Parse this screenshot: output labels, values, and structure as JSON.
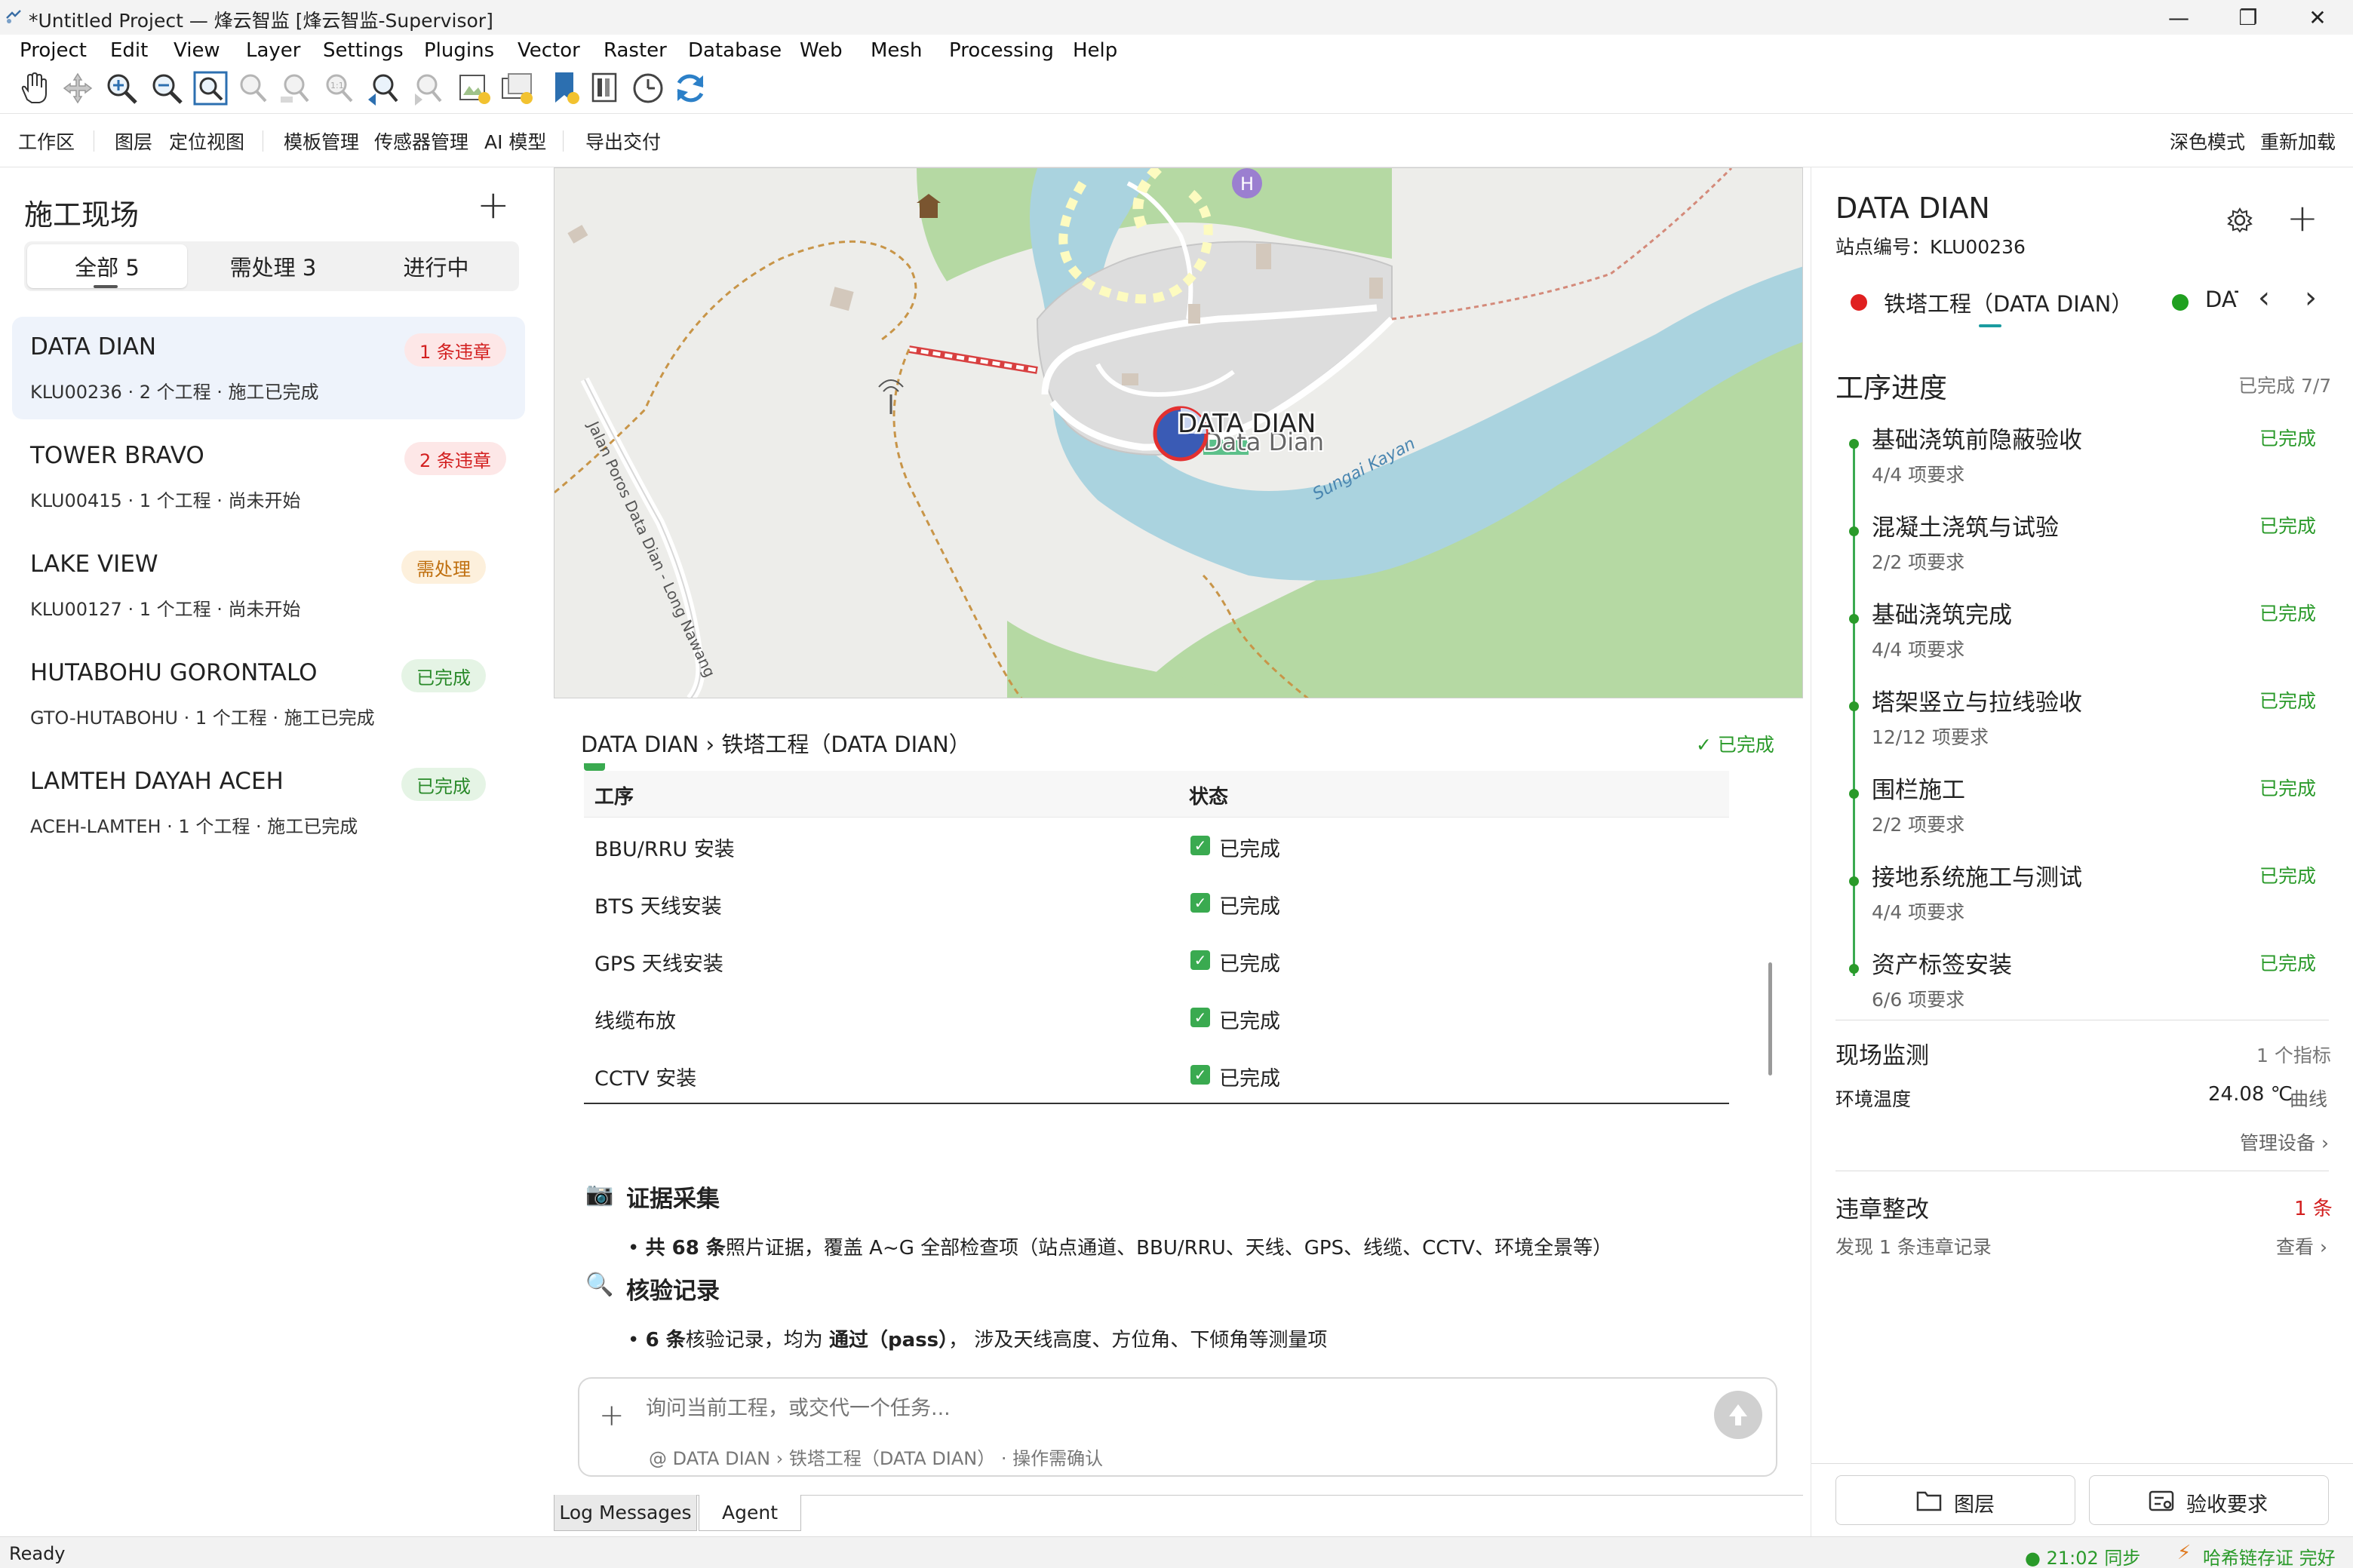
{
  "window": {
    "title": "*Untitled Project — 烽云智监 [烽云智监-Supervisor]",
    "minimize": "—",
    "maximize": "❐",
    "close": "✕"
  },
  "menubar": [
    "Project",
    "Edit",
    "View",
    "Layer",
    "Settings",
    "Plugins",
    "Vector",
    "Raster",
    "Database",
    "Web",
    "Mesh",
    "Processing",
    "Help"
  ],
  "toolbar_icons": [
    "pan-icon",
    "pan-to-selection-icon",
    "zoom-in-icon",
    "zoom-out-icon",
    "zoom-full-icon",
    "zoom-to-selection-icon",
    "zoom-to-layer-icon",
    "zoom-native-icon",
    "zoom-last-icon",
    "zoom-next-icon",
    "new-bookmark-icon",
    "show-bookmarks-icon",
    "spatial-bookmark-icon",
    "temporal-controller-icon",
    "refresh-icon"
  ],
  "navbar": {
    "left": [
      "工作区",
      "图层",
      "定位视图",
      "模板管理",
      "传感器管理",
      "AI 模型",
      "导出交付"
    ],
    "right": [
      "深色模式",
      "重新加载"
    ]
  },
  "sites_panel": {
    "title": "施工现场",
    "add": "+",
    "tabs": [
      {
        "label": "全部 5",
        "active": true
      },
      {
        "label": "需处理 3",
        "active": false
      },
      {
        "label": "进行中",
        "active": false
      }
    ],
    "sites": [
      {
        "name": "DATA DIAN",
        "sub": "KLU00236 · 2 个工程 · 施工已完成",
        "badge": "1 条违章",
        "badge_kind": "red",
        "selected": true
      },
      {
        "name": "TOWER BRAVO",
        "sub": "KLU00415 · 1 个工程 · 尚未开始",
        "badge": "2 条违章",
        "badge_kind": "red",
        "selected": false
      },
      {
        "name": "LAKE VIEW",
        "sub": "KLU00127 · 1 个工程 · 尚未开始",
        "badge": "需处理",
        "badge_kind": "orange",
        "selected": false
      },
      {
        "name": "HUTABOHU GORONTALO",
        "sub": "GTO-HUTABOHU · 1 个工程 · 施工已完成",
        "badge": "已完成",
        "badge_kind": "green",
        "selected": false
      },
      {
        "name": "LAMTEH DAYAH ACEH",
        "sub": "ACEH-LAMTEH · 1 个工程 · 施工已完成",
        "badge": "已完成",
        "badge_kind": "green",
        "selected": false
      }
    ]
  },
  "map": {
    "marker_label": "DATA DIAN",
    "town_label": "Data Dian",
    "river_label": "Sungai Kayan",
    "road_label": "Jalan Poros Data Dian - Long Nawang",
    "hospital_label": "H"
  },
  "detail": {
    "breadcrumb": "DATA DIAN › 铁塔工程（DATA DIAN）",
    "status": "✓ 已完成",
    "table_headers": [
      "工序",
      "状态"
    ],
    "table_rows": [
      {
        "name": "BBU/RRU 安装",
        "status": "已完成"
      },
      {
        "name": "BTS 天线安装",
        "status": "已完成"
      },
      {
        "name": "GPS 天线安装",
        "status": "已完成"
      },
      {
        "name": "线缆布放",
        "status": "已完成"
      },
      {
        "name": "CCTV 安装",
        "status": "已完成"
      }
    ],
    "evidence_title": "证据采集",
    "evidence_bullet_pre": "共 68 条",
    "evidence_bullet_post": "照片证据，覆盖 A~G 全部检查项（站点通道、BBU/RRU、天线、GPS、线缆、CCTV、环境全景等）",
    "inspection_title": "核验记录",
    "inspection_bullet_pre": "6 条",
    "inspection_bullet_mid": "核验记录，均为 ",
    "inspection_bullet_bold": "通过（pass）",
    "inspection_bullet_post": "， 涉及天线高度、方位角、下倾角等测量项"
  },
  "chat": {
    "placeholder": "询问当前工程，或交代一个任务...",
    "context": "@ DATA DIAN › 铁塔工程（DATA DIAN） · 操作需确认",
    "add": "+"
  },
  "bottom_tabs": [
    {
      "label": "Log Messages",
      "active": true
    },
    {
      "label": "Agent",
      "active": false
    }
  ],
  "right_panel": {
    "site_title": "DATA DIAN",
    "site_code": "站点编号：KLU00236",
    "add": "+",
    "project_tabs": [
      {
        "label": "铁塔工程（DATA DIAN）",
        "dot_color": "#e02020"
      },
      {
        "label": "DAT",
        "dot_color": "#20a020"
      }
    ],
    "progress_title": "工序进度",
    "progress_summary": "已完成 7/7",
    "steps": [
      {
        "name": "基础浇筑前隐蔽验收",
        "sub": "4/4 项要求",
        "status": "已完成"
      },
      {
        "name": "混凝土浇筑与试验",
        "sub": "2/2 项要求",
        "status": "已完成"
      },
      {
        "name": "基础浇筑完成",
        "sub": "4/4 项要求",
        "status": "已完成"
      },
      {
        "name": "塔架竖立与拉线验收",
        "sub": "12/12 项要求",
        "status": "已完成"
      },
      {
        "name": "围栏施工",
        "sub": "2/2 项要求",
        "status": "已完成"
      },
      {
        "name": "接地系统施工与测试",
        "sub": "4/4 项要求",
        "status": "已完成"
      },
      {
        "name": "资产标签安装",
        "sub": "6/6 项要求",
        "status": "已完成"
      }
    ],
    "monitor_title": "现场监测",
    "monitor_count": "1 个指标",
    "temp_label": "环境温度",
    "temp_value": "24.08 ℃",
    "temp_link": "曲线",
    "manage_link": "管理设备 ›",
    "violation_title": "违章整改",
    "violation_count": "1 条",
    "violation_desc": "发现 1 条违章记录",
    "violation_link": "查看 ›",
    "btn_layers": "图层",
    "btn_acceptance": "验收要求"
  },
  "statusbar": {
    "left": "Ready",
    "sync": "● 21:02 同步",
    "chain": "哈希链存证 完好"
  },
  "colors": {
    "accent": "#1a9ba0",
    "success": "#2a9a2a",
    "danger": "#d32020",
    "warning": "#c07010"
  }
}
